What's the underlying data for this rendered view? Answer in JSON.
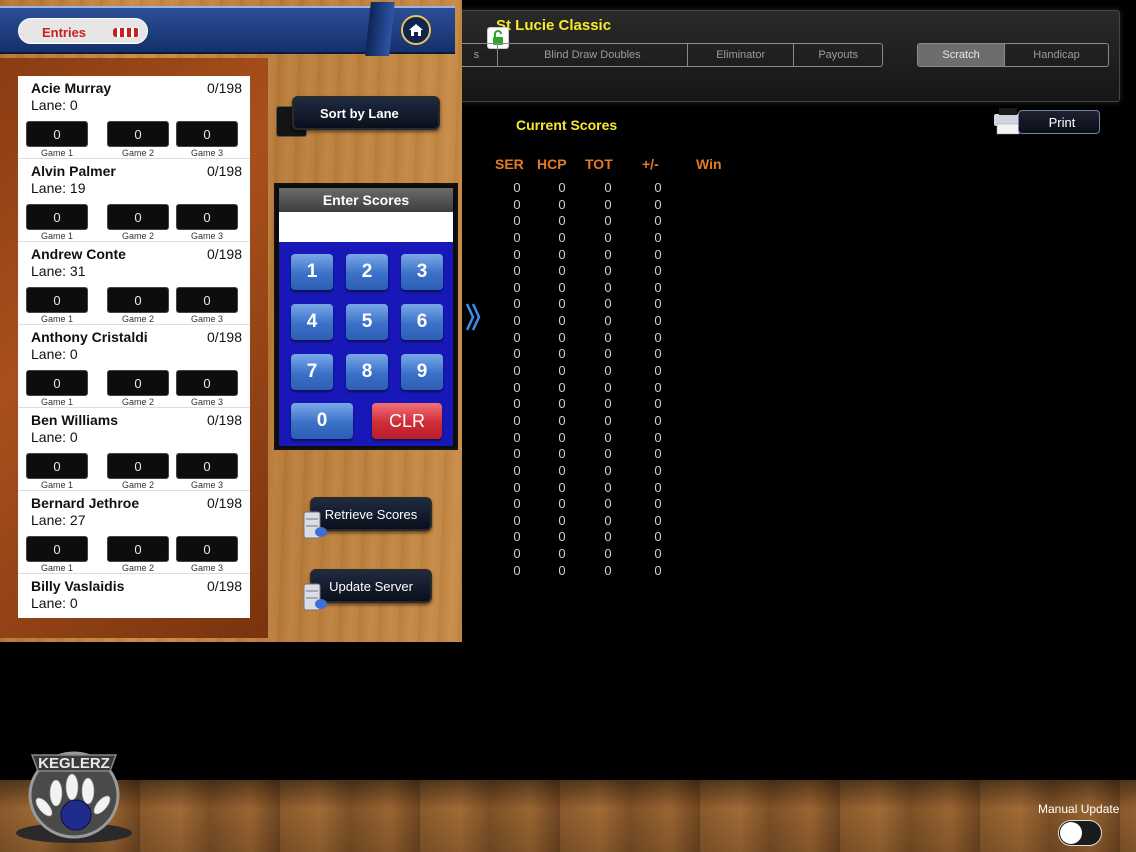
{
  "event": {
    "title": "St Lucie Classic"
  },
  "tabs": [
    {
      "label": "s"
    },
    {
      "label": "Blind Draw Doubles"
    },
    {
      "label": "Eliminator"
    },
    {
      "label": "Payouts"
    }
  ],
  "score_type": {
    "options": [
      "Scratch",
      "Handicap"
    ],
    "selected": "Scratch"
  },
  "header": {
    "entries_label": "Entries"
  },
  "sort": {
    "label": "Sort by Lane"
  },
  "entries": [
    {
      "name": "Acie Murray",
      "avg": "0/198",
      "lane": "Lane: 0",
      "games": [
        "0",
        "0",
        "0"
      ]
    },
    {
      "name": "Alvin Palmer",
      "avg": "0/198",
      "lane": "Lane: 19",
      "games": [
        "0",
        "0",
        "0"
      ]
    },
    {
      "name": "Andrew Conte",
      "avg": "0/198",
      "lane": "Lane: 31",
      "games": [
        "0",
        "0",
        "0"
      ]
    },
    {
      "name": "Anthony Cristaldi",
      "avg": "0/198",
      "lane": "Lane: 0",
      "games": [
        "0",
        "0",
        "0"
      ]
    },
    {
      "name": "Ben Williams",
      "avg": "0/198",
      "lane": "Lane: 0",
      "games": [
        "0",
        "0",
        "0"
      ]
    },
    {
      "name": "Bernard Jethroe",
      "avg": "0/198",
      "lane": "Lane: 27",
      "games": [
        "0",
        "0",
        "0"
      ]
    },
    {
      "name": "Billy Vaslaidis",
      "avg": "0/198",
      "lane": "Lane: 0",
      "games": []
    }
  ],
  "game_labels": [
    "Game 1",
    "Game 2",
    "Game 3"
  ],
  "keypad": {
    "title": "Enter Scores",
    "keys": [
      "1",
      "2",
      "3",
      "4",
      "5",
      "6",
      "7",
      "8",
      "9",
      "0",
      "CLR"
    ]
  },
  "buttons": {
    "retrieve": "Retrieve Scores",
    "update": "Update Server",
    "print": "Print"
  },
  "scores": {
    "title": "Current Scores",
    "columns": [
      "SER",
      "HCP",
      "TOT",
      "+/-",
      "Win"
    ],
    "value": "0",
    "row_count": 24
  },
  "footer": {
    "manual_update_label": "Manual Update",
    "manual_update_on": false,
    "logo_text": "KEGLERZ"
  },
  "colors": {
    "accent_yellow": "#f6ea2a",
    "header_orange": "#e47a22",
    "keypad_blue": "#1818b8",
    "clear_red": "#d02c38"
  }
}
